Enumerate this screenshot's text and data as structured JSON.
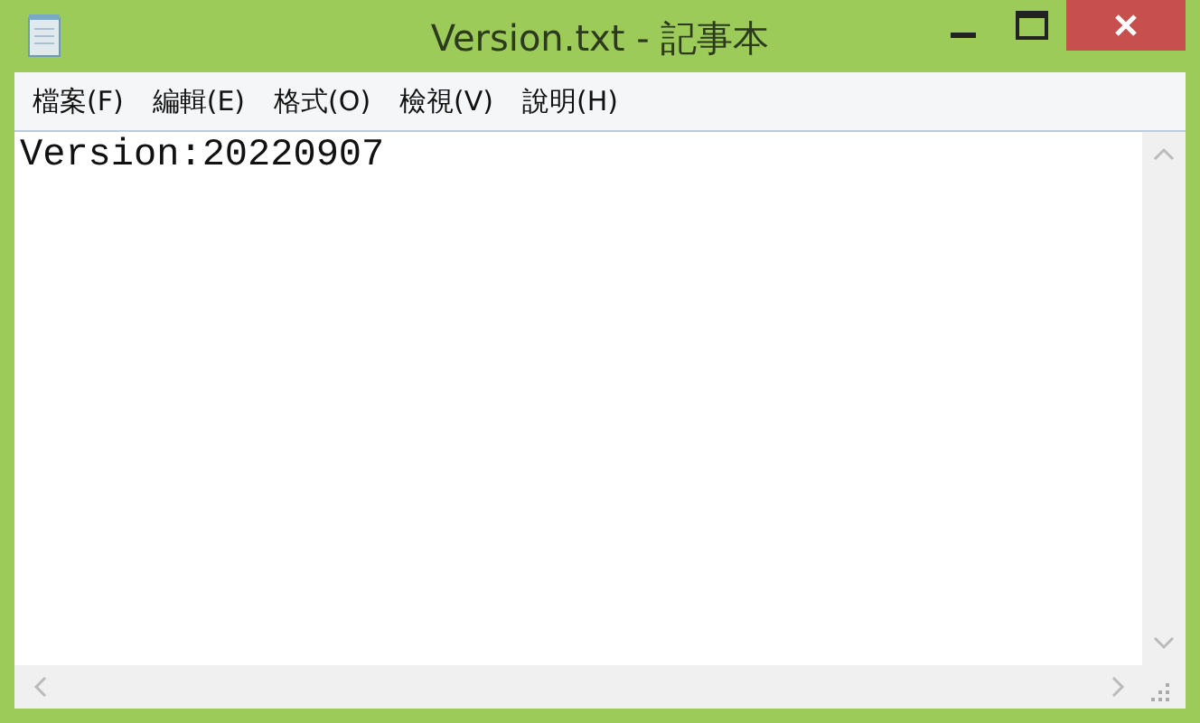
{
  "window": {
    "title": "Version.txt - 記事本"
  },
  "menu": [
    "檔案(F)",
    "編輯(E)",
    "格式(O)",
    "檢視(V)",
    "說明(H)"
  ],
  "document": {
    "text": "Version:20220907"
  }
}
